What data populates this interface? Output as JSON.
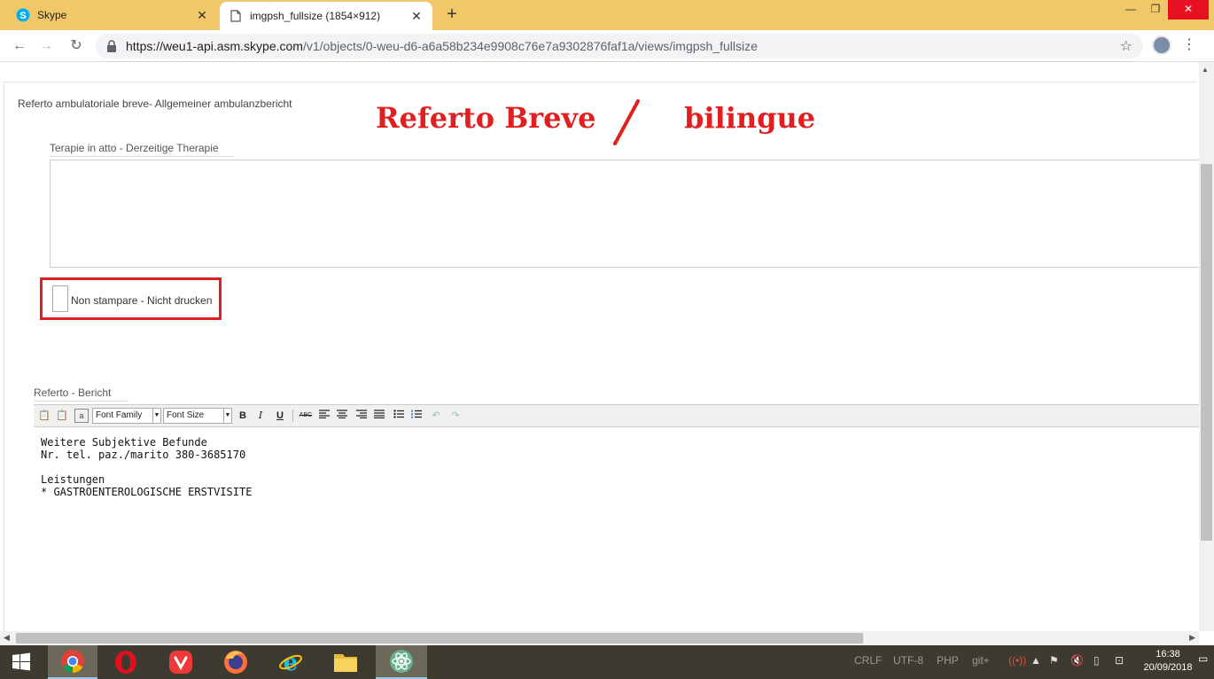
{
  "browser": {
    "tabs": [
      {
        "title": "Skype",
        "active": false,
        "favicon": "skype-icon"
      },
      {
        "title": "imgpsh_fullsize (1854×912)",
        "active": true,
        "favicon": "document-icon"
      }
    ],
    "new_tab": "+",
    "address": {
      "host": "https://weu1-api.asm.skype.com",
      "path": "/v1/objects/0-weu-d6-a6a58b234e9908c76e7a9302876faf1a/views/imgpsh_fullsize"
    }
  },
  "page": {
    "form_heading": "Referto ambulatoriale breve- Allgemeiner ambulanzbericht",
    "banner_left": "Referto Breve",
    "banner_right": "bilingue",
    "therapy_label": "Terapie in atto - Derzeitige Therapie",
    "therapy_value": "",
    "no_print_label": "Non stampare - Nicht drucken",
    "no_print_checked": false,
    "report_label": "Referto - Bericht",
    "editor": {
      "font_family": "Font Family",
      "font_size": "Font Size",
      "bold": "B",
      "italic": "I",
      "underline": "U",
      "strike": "ABC",
      "lines": [
        "Weitere Subjektive Befunde",
        "Nr. tel. paz./marito 380-3685170",
        "",
        "Leistungen",
        "* GASTROENTEROLOGISCHE ERSTVISITE"
      ]
    }
  },
  "taskbar": {
    "apps": [
      "windows-start",
      "chrome",
      "opera",
      "vivaldi",
      "firefox",
      "internet-explorer",
      "file-explorer",
      "atom"
    ],
    "tray_labels": [
      "CRLF",
      "UTF-8",
      "PHP",
      "git+"
    ],
    "time": "16:38",
    "date": "20/09/2018"
  },
  "colors": {
    "tabstrip": "#f0c869",
    "annotation_red": "#e02020",
    "taskbar": "#3d3a30"
  }
}
